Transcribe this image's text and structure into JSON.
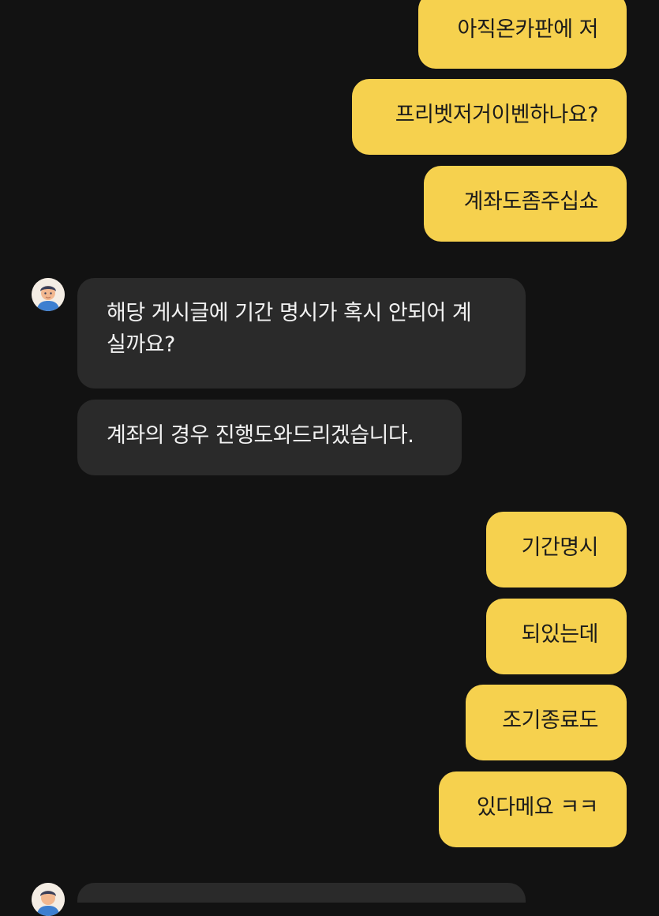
{
  "messages": [
    {
      "sender": "me",
      "text": "아직온카판에 저"
    },
    {
      "sender": "me",
      "text": "프리벳저거이벤하나요?"
    },
    {
      "sender": "me",
      "text": "계좌도좀주십쇼"
    },
    {
      "sender": "agent",
      "text": "해당 게시글에 기간 명시가 혹시 안되어 계\n실까요?"
    },
    {
      "sender": "agent",
      "text": "계좌의 경우 진행도와드리겠습니다."
    },
    {
      "sender": "me",
      "text": "기간명시"
    },
    {
      "sender": "me",
      "text": "되있는데"
    },
    {
      "sender": "me",
      "text": "조기종료도"
    },
    {
      "sender": "me",
      "text": "있다메요 ㅋㅋ"
    },
    {
      "sender": "agent",
      "text": ""
    }
  ],
  "colors": {
    "background": "#121212",
    "my_bubble": "#f6d14e",
    "agent_bubble": "#2a2a2a"
  },
  "icons": {
    "agent_avatar": "user-avatar-icon"
  }
}
